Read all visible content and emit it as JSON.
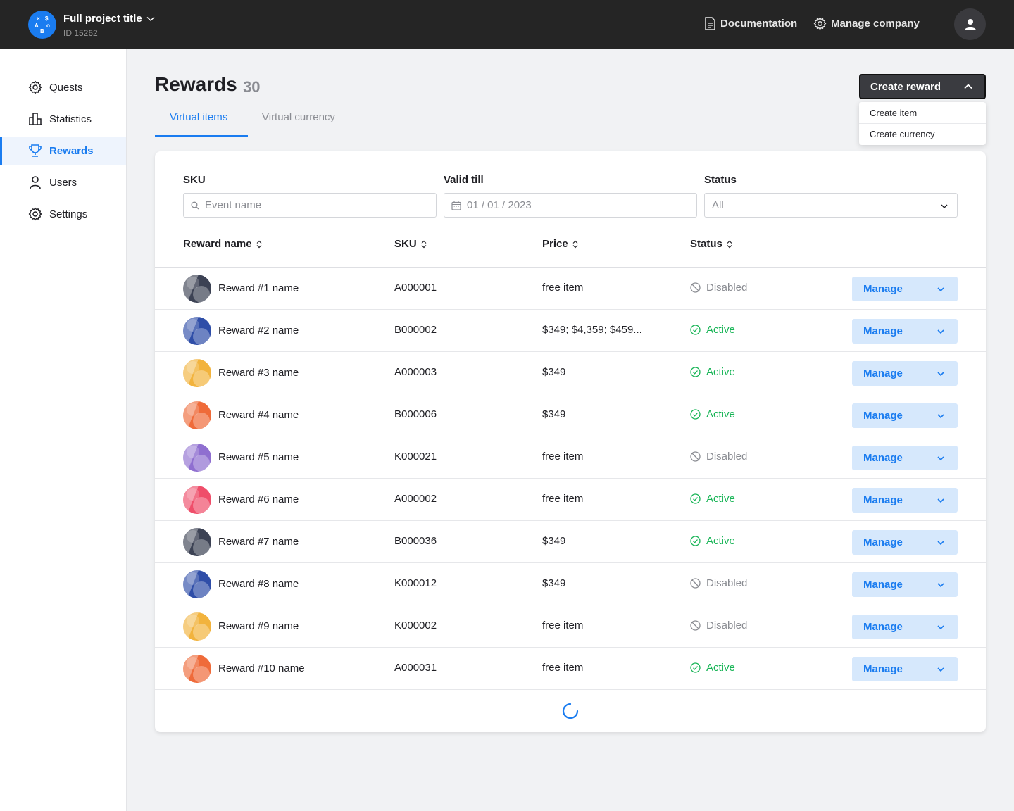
{
  "header": {
    "project_title": "Full project title",
    "project_id": "ID 15262",
    "logo_glyphs": [
      "×",
      "$",
      "A",
      "o",
      "B"
    ],
    "documentation_label": "Documentation",
    "manage_company_label": "Manage company"
  },
  "sidebar": {
    "items": [
      {
        "label": "Quests",
        "icon": "gear-icon"
      },
      {
        "label": "Statistics",
        "icon": "bar-chart-icon"
      },
      {
        "label": "Rewards",
        "icon": "trophy-icon",
        "active": true
      },
      {
        "label": "Users",
        "icon": "user-icon"
      },
      {
        "label": "Settings",
        "icon": "gear-icon"
      }
    ]
  },
  "page": {
    "title": "Rewards",
    "count": "30",
    "tabs": [
      {
        "label": "Virtual items",
        "active": true
      },
      {
        "label": "Virtual currency",
        "active": false
      }
    ]
  },
  "create_reward": {
    "label": "Create reward",
    "menu": [
      "Create item",
      "Create currency"
    ]
  },
  "filters": {
    "sku_label": "SKU",
    "sku_placeholder": "Event name",
    "valid_till_label": "Valid till",
    "valid_till_value": "01 / 01 / 2023",
    "status_label": "Status",
    "status_value": "All"
  },
  "table": {
    "columns": [
      "Reward name",
      "SKU",
      "Price",
      "Status"
    ],
    "manage_label": "Manage",
    "rows": [
      {
        "name": "Reward #1 name",
        "sku": "A000001",
        "price": "free item",
        "status": "Disabled",
        "color": "#3c4254"
      },
      {
        "name": "Reward #2 name",
        "sku": "B000002",
        "price": "$349; $4,359; $459...",
        "status": "Active",
        "color": "#2f4ea8"
      },
      {
        "name": "Reward #3 name",
        "sku": "A000003",
        "price": "$349",
        "status": "Active",
        "color": "#f2b33d"
      },
      {
        "name": "Reward #4 name",
        "sku": "B000006",
        "price": "$349",
        "status": "Active",
        "color": "#ef6b3a"
      },
      {
        "name": "Reward #5 name",
        "sku": "K000021",
        "price": "free item",
        "status": "Disabled",
        "color": "#8f6fd0"
      },
      {
        "name": "Reward #6 name",
        "sku": "A000002",
        "price": "free item",
        "status": "Active",
        "color": "#ef4e6a"
      },
      {
        "name": "Reward #7 name",
        "sku": "B000036",
        "price": "$349",
        "status": "Active",
        "color": "#3c4254"
      },
      {
        "name": "Reward #8 name",
        "sku": "K000012",
        "price": "$349",
        "status": "Disabled",
        "color": "#2f4ea8"
      },
      {
        "name": "Reward #9 name",
        "sku": "K000002",
        "price": "free item",
        "status": "Disabled",
        "color": "#f2b33d"
      },
      {
        "name": "Reward #10 name",
        "sku": "A000031",
        "price": "free item",
        "status": "Active",
        "color": "#ef6b3a"
      }
    ]
  },
  "colors": {
    "accent": "#1a7cf0",
    "active_status": "#16b455",
    "disabled_status": "#8a8c92",
    "topbar": "#252525"
  }
}
